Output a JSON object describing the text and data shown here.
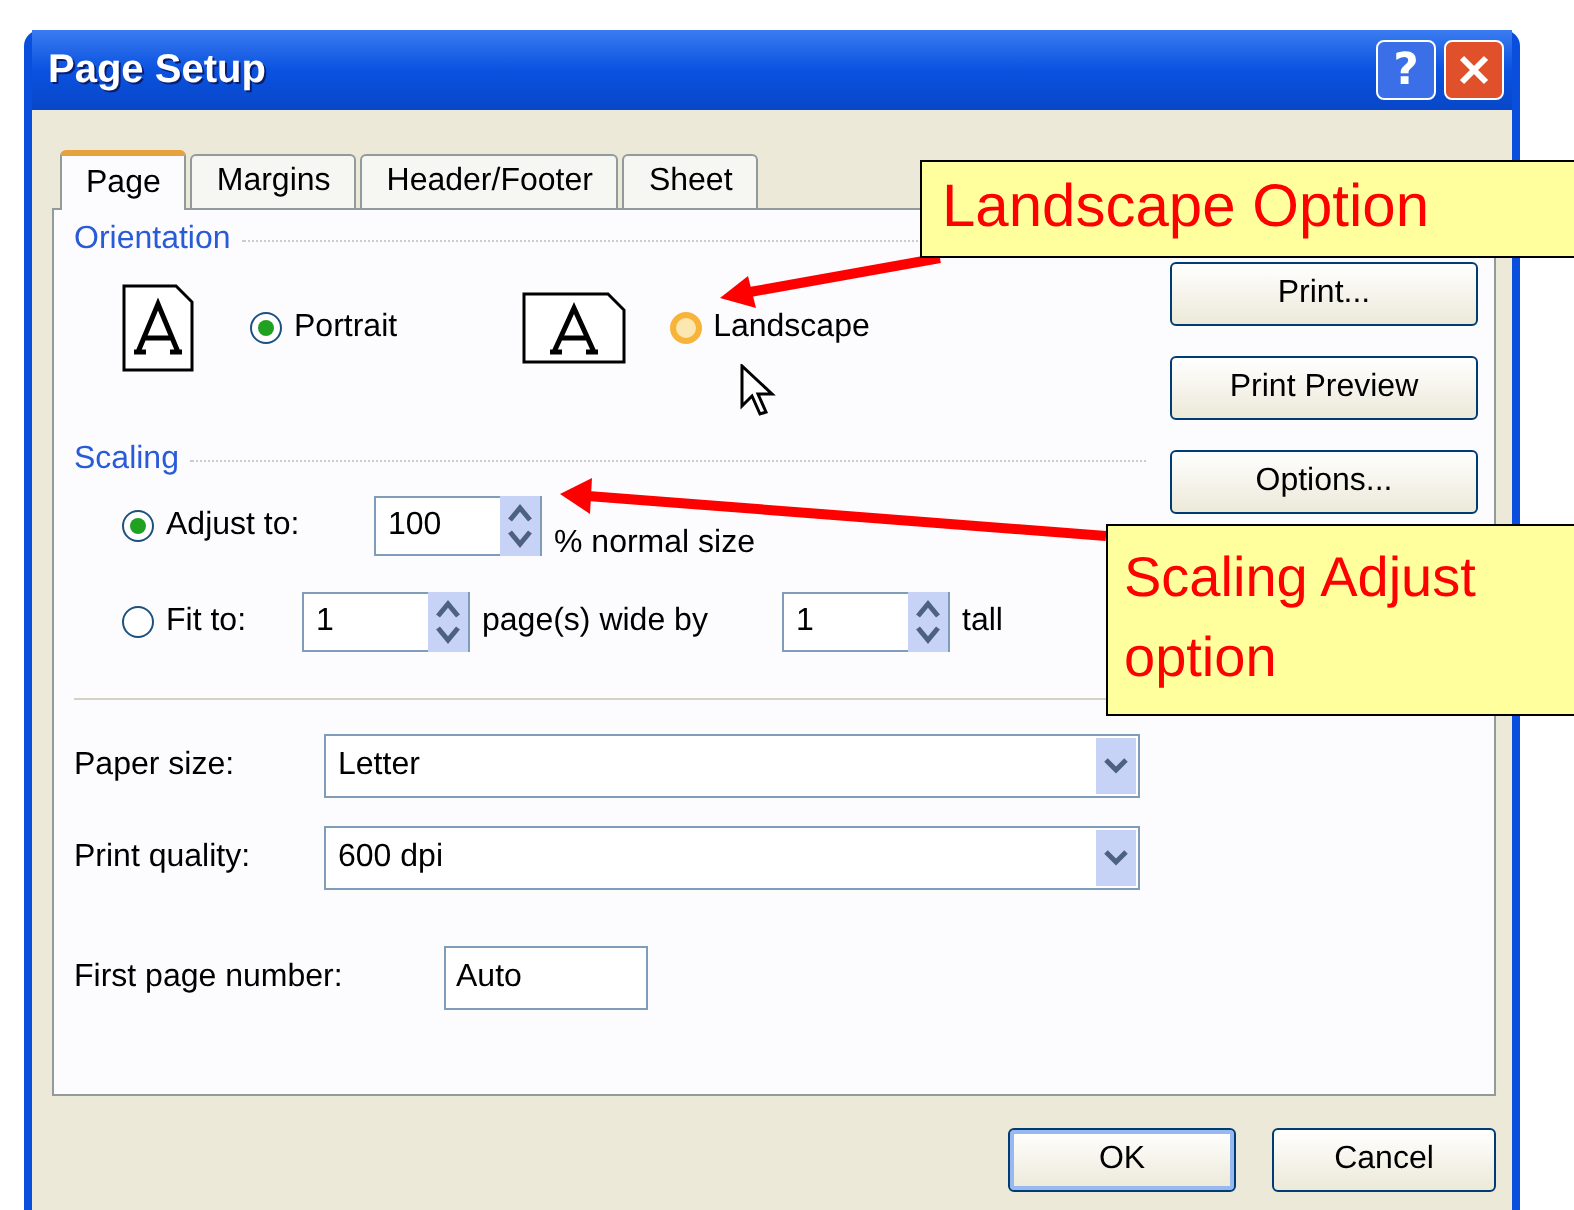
{
  "window": {
    "title": "Page Setup",
    "help": "?"
  },
  "tabs": [
    {
      "label": "Page",
      "selected": true
    },
    {
      "label": "Margins",
      "selected": false
    },
    {
      "label": "Header/Footer",
      "selected": false
    },
    {
      "label": "Sheet",
      "selected": false
    }
  ],
  "orientation": {
    "heading": "Orientation",
    "options": [
      {
        "label": "Portrait",
        "selected": true
      },
      {
        "label": "Landscape",
        "selected": false
      }
    ]
  },
  "scaling": {
    "heading": "Scaling",
    "adjust": {
      "label": "Adjust to:",
      "selected": true,
      "value": "100",
      "suffix": "% normal size"
    },
    "fit": {
      "label": "Fit to:",
      "selected": false,
      "wide_value": "1",
      "wide_label": "page(s) wide by",
      "tall_value": "1",
      "tall_label": "tall"
    }
  },
  "paper_size": {
    "label": "Paper size:",
    "value": "Letter"
  },
  "print_quality": {
    "label": "Print quality:",
    "value": "600 dpi"
  },
  "first_page_number": {
    "label": "First page number:",
    "value": "Auto"
  },
  "side_buttons": [
    "Print...",
    "Print Preview",
    "Options..."
  ],
  "buttons": [
    "OK",
    "Cancel"
  ],
  "callouts": [
    {
      "text": "Landscape Option"
    },
    {
      "text": "Scaling Adjust option"
    }
  ]
}
